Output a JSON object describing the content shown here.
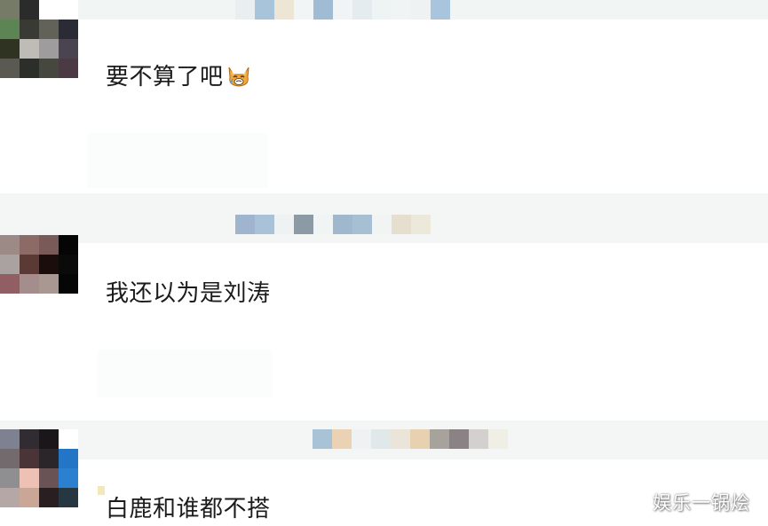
{
  "comments": [
    {
      "text": "要不算了吧",
      "emoji": "weary-cat-emoji"
    },
    {
      "text": "我还以为是刘涛"
    },
    {
      "text": "白鹿和谁都不搭"
    }
  ],
  "watermark": "娱乐一锅烩",
  "colors": {
    "background": "#ffffff",
    "band": "#f1f5f4",
    "text": "#1b1b1b"
  }
}
